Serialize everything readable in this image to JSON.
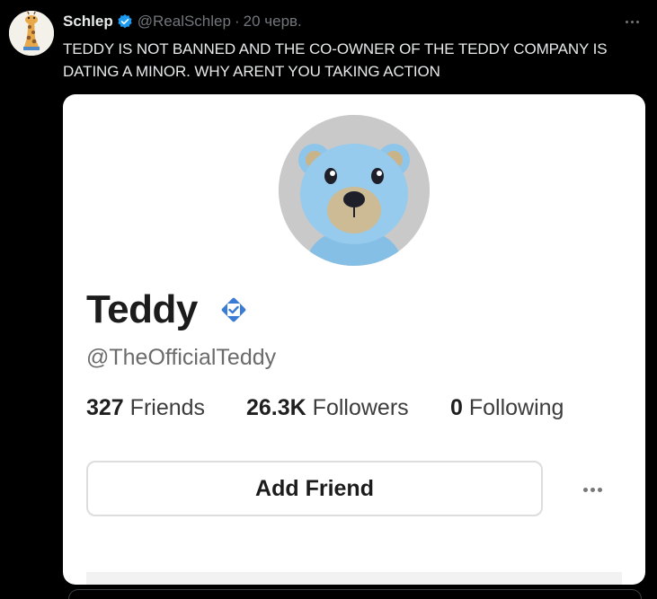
{
  "tweet": {
    "display_name": "Schlep",
    "handle": "@RealSchlep",
    "separator": "·",
    "time": "20 черв.",
    "text": "TEDDY IS NOT BANNED AND THE CO-OWNER OF THE TEDDY COMPANY IS DATING A MINOR. WHY ARENT YOU TAKING ACTION",
    "avatar_icon": "giraffe-avatar",
    "verified_icon": "verified-badge-icon",
    "more_icon": "more-options-icon"
  },
  "profile_card": {
    "avatar_icon": "blue-teddy-bear-avatar",
    "name": "Teddy",
    "verified_icon": "roblox-verified-badge-icon",
    "handle": "@TheOfficialTeddy",
    "stats": {
      "friends_count": "327",
      "friends_label": "Friends",
      "followers_count": "26.3K",
      "followers_label": "Followers",
      "following_count": "0",
      "following_label": "Following"
    },
    "add_friend_label": "Add Friend",
    "more_icon": "more-options-icon"
  },
  "colors": {
    "background": "#000000",
    "text_primary": "#e7e9ea",
    "text_secondary": "#71767b",
    "verified_blue": "#1d9bf0",
    "card_background": "#ffffff",
    "roblox_badge_blue": "#3a7bd5",
    "bear_blue": "#8ec5ea"
  }
}
